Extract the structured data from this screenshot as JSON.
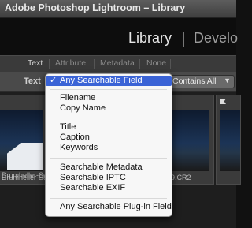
{
  "window": {
    "title": "Adobe Photoshop Lightroom – Library"
  },
  "modules": {
    "active": "Library",
    "next": "Develo"
  },
  "filter_bar": {
    "buttons": [
      "Text",
      "Attribute",
      "Metadata",
      "None"
    ],
    "active": "Text"
  },
  "search_bar": {
    "label": "Text",
    "field_value": "Any Searchable Field",
    "rule_value": "Contains All"
  },
  "menu": {
    "selected": "Any Searchable Field",
    "items": [
      "Any Searchable Field",
      "Filename",
      "Copy Name",
      "Title",
      "Caption",
      "Keywords",
      "Searchable Metadata",
      "Searchable IPTC",
      "Searchable EXIF",
      "Any Searchable Plug-in Field"
    ]
  },
  "grid": {
    "captions": [
      "Drumheller-Sep-",
      "Drumheller-Sep-",
      "9.CR2"
    ]
  },
  "colors": {
    "menu_highlight": "#3a63d6",
    "photo_sky": "#1c3456"
  }
}
